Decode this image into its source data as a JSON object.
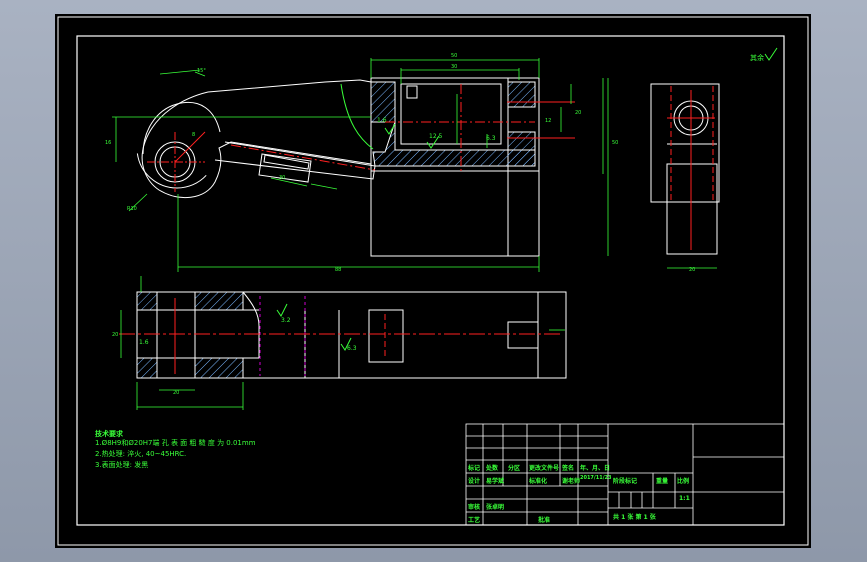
{
  "colors": {
    "background": "#000000",
    "outline": "#ffffff",
    "dimension": "#39ff39",
    "centerline": "#ff2020",
    "hidden_line": "#d000d0",
    "hatch": "#7ab8ff"
  },
  "dimensions": {
    "total_length": "88",
    "top_width": "50",
    "top_inner": "30",
    "radius_r5": "5",
    "height_side": "16",
    "height_block": "50",
    "height_small": "20",
    "dia_bore": "8",
    "angle_15": "15°",
    "slot_len": "30",
    "side_w": "12",
    "pos_20": "20",
    "r10": "R10",
    "ra_16": "1.6",
    "ra_125": "12.5",
    "ra_63": "6.3",
    "ra_32": "3.2",
    "sec_h": "20",
    "sec_bot": "20"
  },
  "roughness_note": "其余",
  "tech_requirements": {
    "title": "技术要求",
    "lines": [
      "1.Ø8H9和Ø20H7端 孔 表 面 粗 糙 度 为 0.01mm",
      "2.热处理: 淬火, 40~45HRC.",
      "3.表面处理: 发黑"
    ]
  },
  "title_block": {
    "rev_headers": [
      "标记",
      "处数",
      "分区",
      "更改文件号",
      "签名",
      "年、月、日"
    ],
    "designer_label": "设计",
    "designer_name": "易学斌",
    "standardize_label": "标准化",
    "approve_sign": "谢老师",
    "date_value": "2017/11/23",
    "stage_label": "阶段标记",
    "weight_label": "重量",
    "scale_label": "比例",
    "scale_value": "1:1",
    "review_label": "审核",
    "reviewer_name": "张卓明",
    "process_label": "工艺",
    "approve_label": "批准",
    "sheets_text": "共  1  张    第  1  张"
  }
}
